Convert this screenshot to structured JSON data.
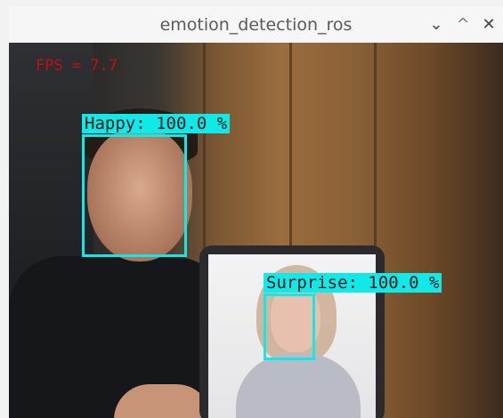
{
  "window": {
    "title": "emotion_detection_ros",
    "controls": {
      "minimize": "⌄",
      "maximize": "^",
      "close": "✕"
    }
  },
  "overlay": {
    "fps_text": "FPS = 7.7",
    "detections": [
      {
        "label": "Happy: 100.0 %"
      },
      {
        "label": "Surprise: 100.0 %"
      }
    ],
    "box_color": "#11e8e8",
    "fps_color": "#c01010"
  }
}
